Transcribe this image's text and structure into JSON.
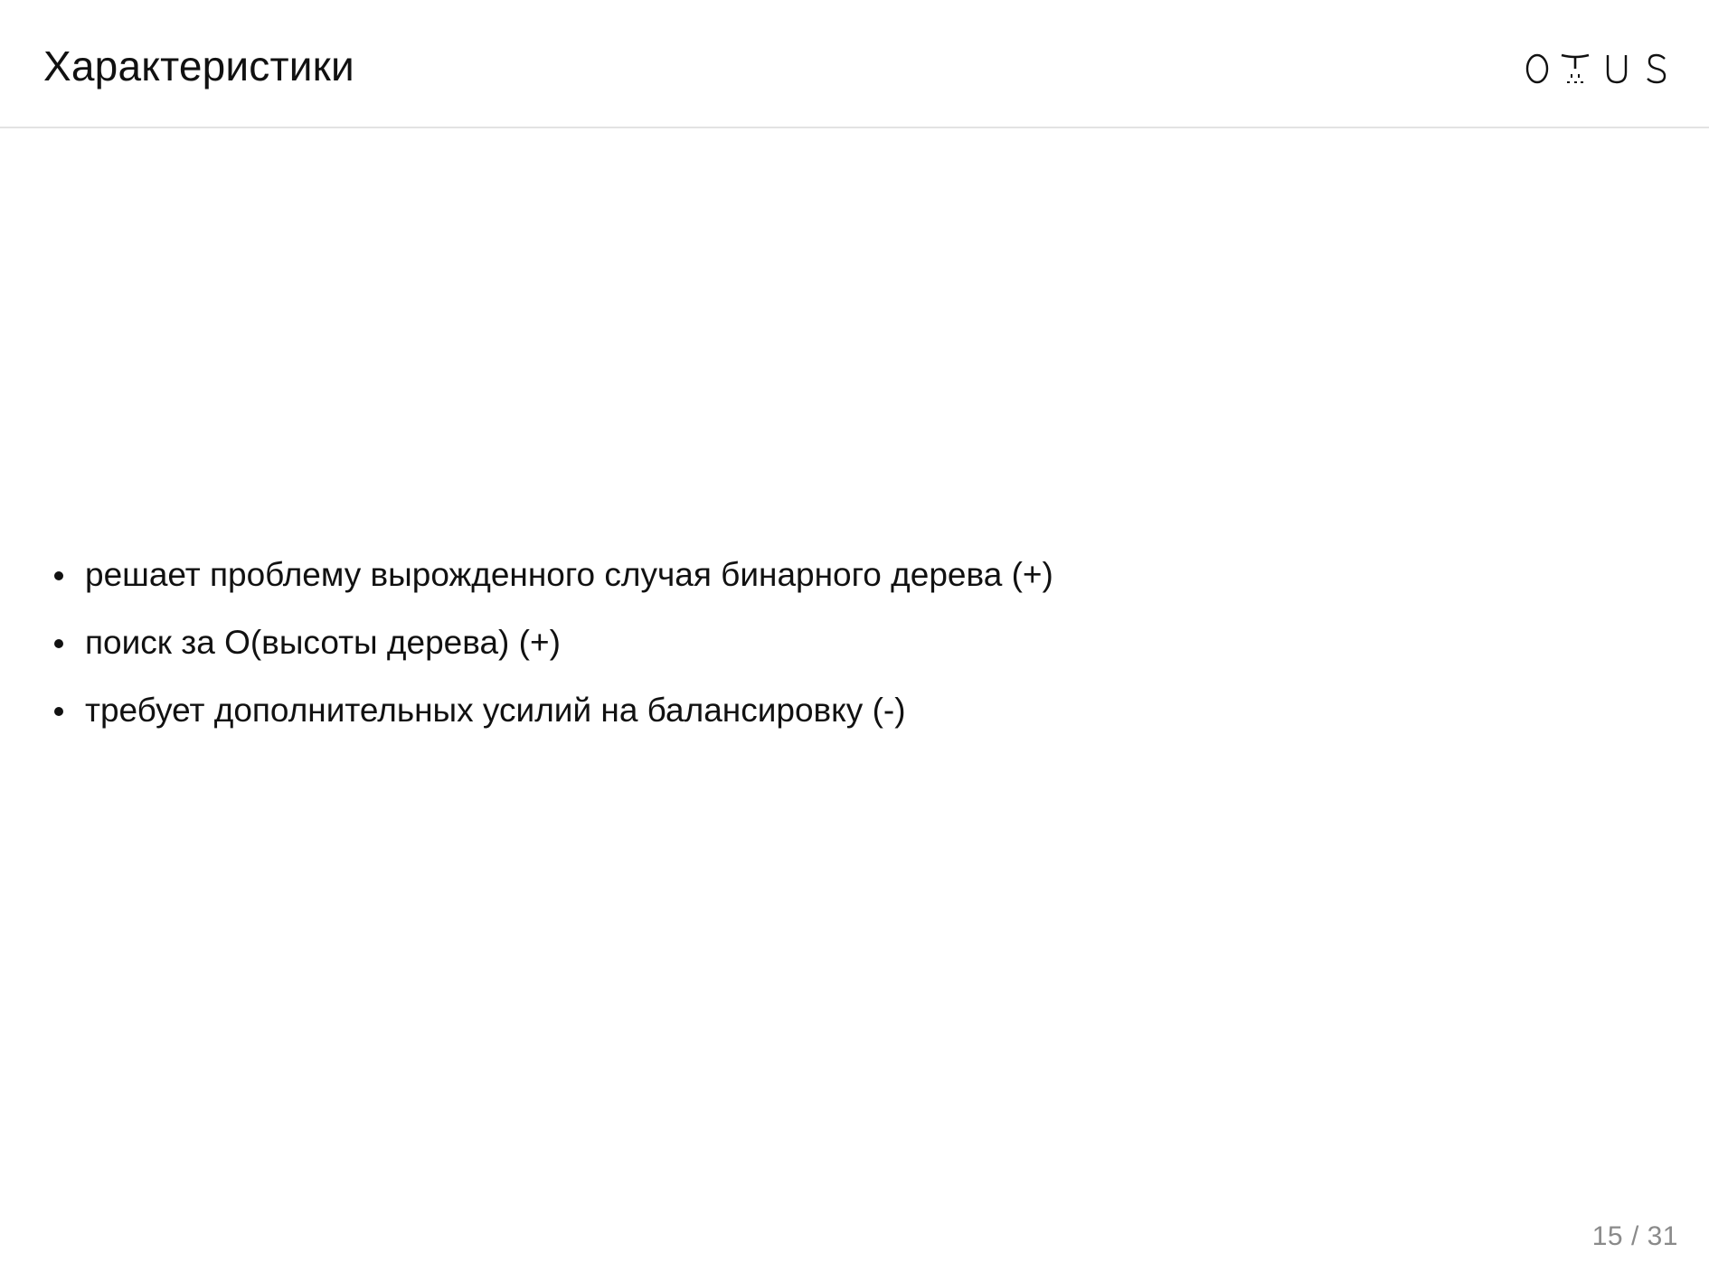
{
  "slide": {
    "title": "Характеристики",
    "logo_text": "OTUS",
    "bullets": [
      "решает проблему вырожденного случая бинарного дерева (+)",
      "поиск за O(высоты дерева) (+)",
      "требует дополнительных усилий на балансировку (-)"
    ],
    "page_number": "15 / 31"
  },
  "colors": {
    "text": "#111111",
    "divider": "#e3e3e3",
    "page_number": "#8a8a8a",
    "background": "#ffffff"
  }
}
